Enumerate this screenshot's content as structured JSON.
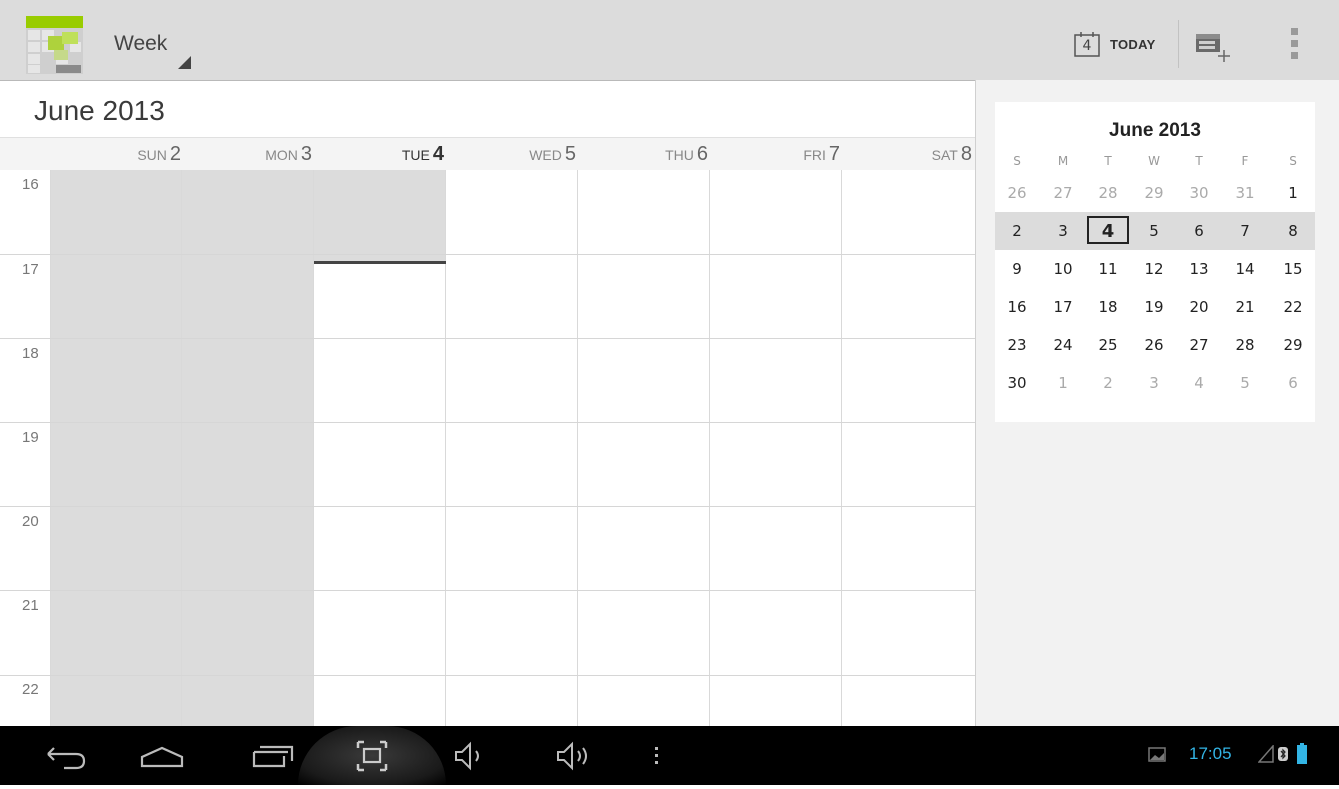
{
  "action_bar": {
    "app_icon": "calendar-app-icon",
    "view_label": "Week",
    "today_icon_number": "4",
    "today_label": "TODAY",
    "new_event_icon": "new-event-icon",
    "overflow_icon": "overflow-menu-icon"
  },
  "main": {
    "month_title": "June 2013",
    "days": [
      {
        "name": "SUN",
        "num": "2"
      },
      {
        "name": "MON",
        "num": "3"
      },
      {
        "name": "TUE",
        "num": "4"
      },
      {
        "name": "WED",
        "num": "5"
      },
      {
        "name": "THU",
        "num": "6"
      },
      {
        "name": "FRI",
        "num": "7"
      },
      {
        "name": "SAT",
        "num": "8"
      }
    ],
    "today_index": 2,
    "hours": [
      "16",
      "17",
      "18",
      "19",
      "20",
      "21",
      "22"
    ]
  },
  "mini_calendar": {
    "title": "June 2013",
    "dow": [
      "S",
      "M",
      "T",
      "W",
      "T",
      "F",
      "S"
    ],
    "weeks": [
      [
        "26",
        "27",
        "28",
        "29",
        "30",
        "31",
        "1"
      ],
      [
        "2",
        "3",
        "4",
        "5",
        "6",
        "7",
        "8"
      ],
      [
        "9",
        "10",
        "11",
        "12",
        "13",
        "14",
        "15"
      ],
      [
        "16",
        "17",
        "18",
        "19",
        "20",
        "21",
        "22"
      ],
      [
        "23",
        "24",
        "25",
        "26",
        "27",
        "28",
        "29"
      ],
      [
        "30",
        "1",
        "2",
        "3",
        "4",
        "5",
        "6"
      ]
    ],
    "selected": "4",
    "accent_color": "#33b5e5"
  },
  "nav_bar": {
    "back_icon": "back-icon",
    "home_icon": "home-icon",
    "recents_icon": "recent-apps-icon",
    "screenshot_icon": "screenshot-icon",
    "vol_down_icon": "volume-down-icon",
    "vol_up_icon": "volume-up-icon",
    "menu_icon": "menu-icon",
    "time": "17:05"
  }
}
